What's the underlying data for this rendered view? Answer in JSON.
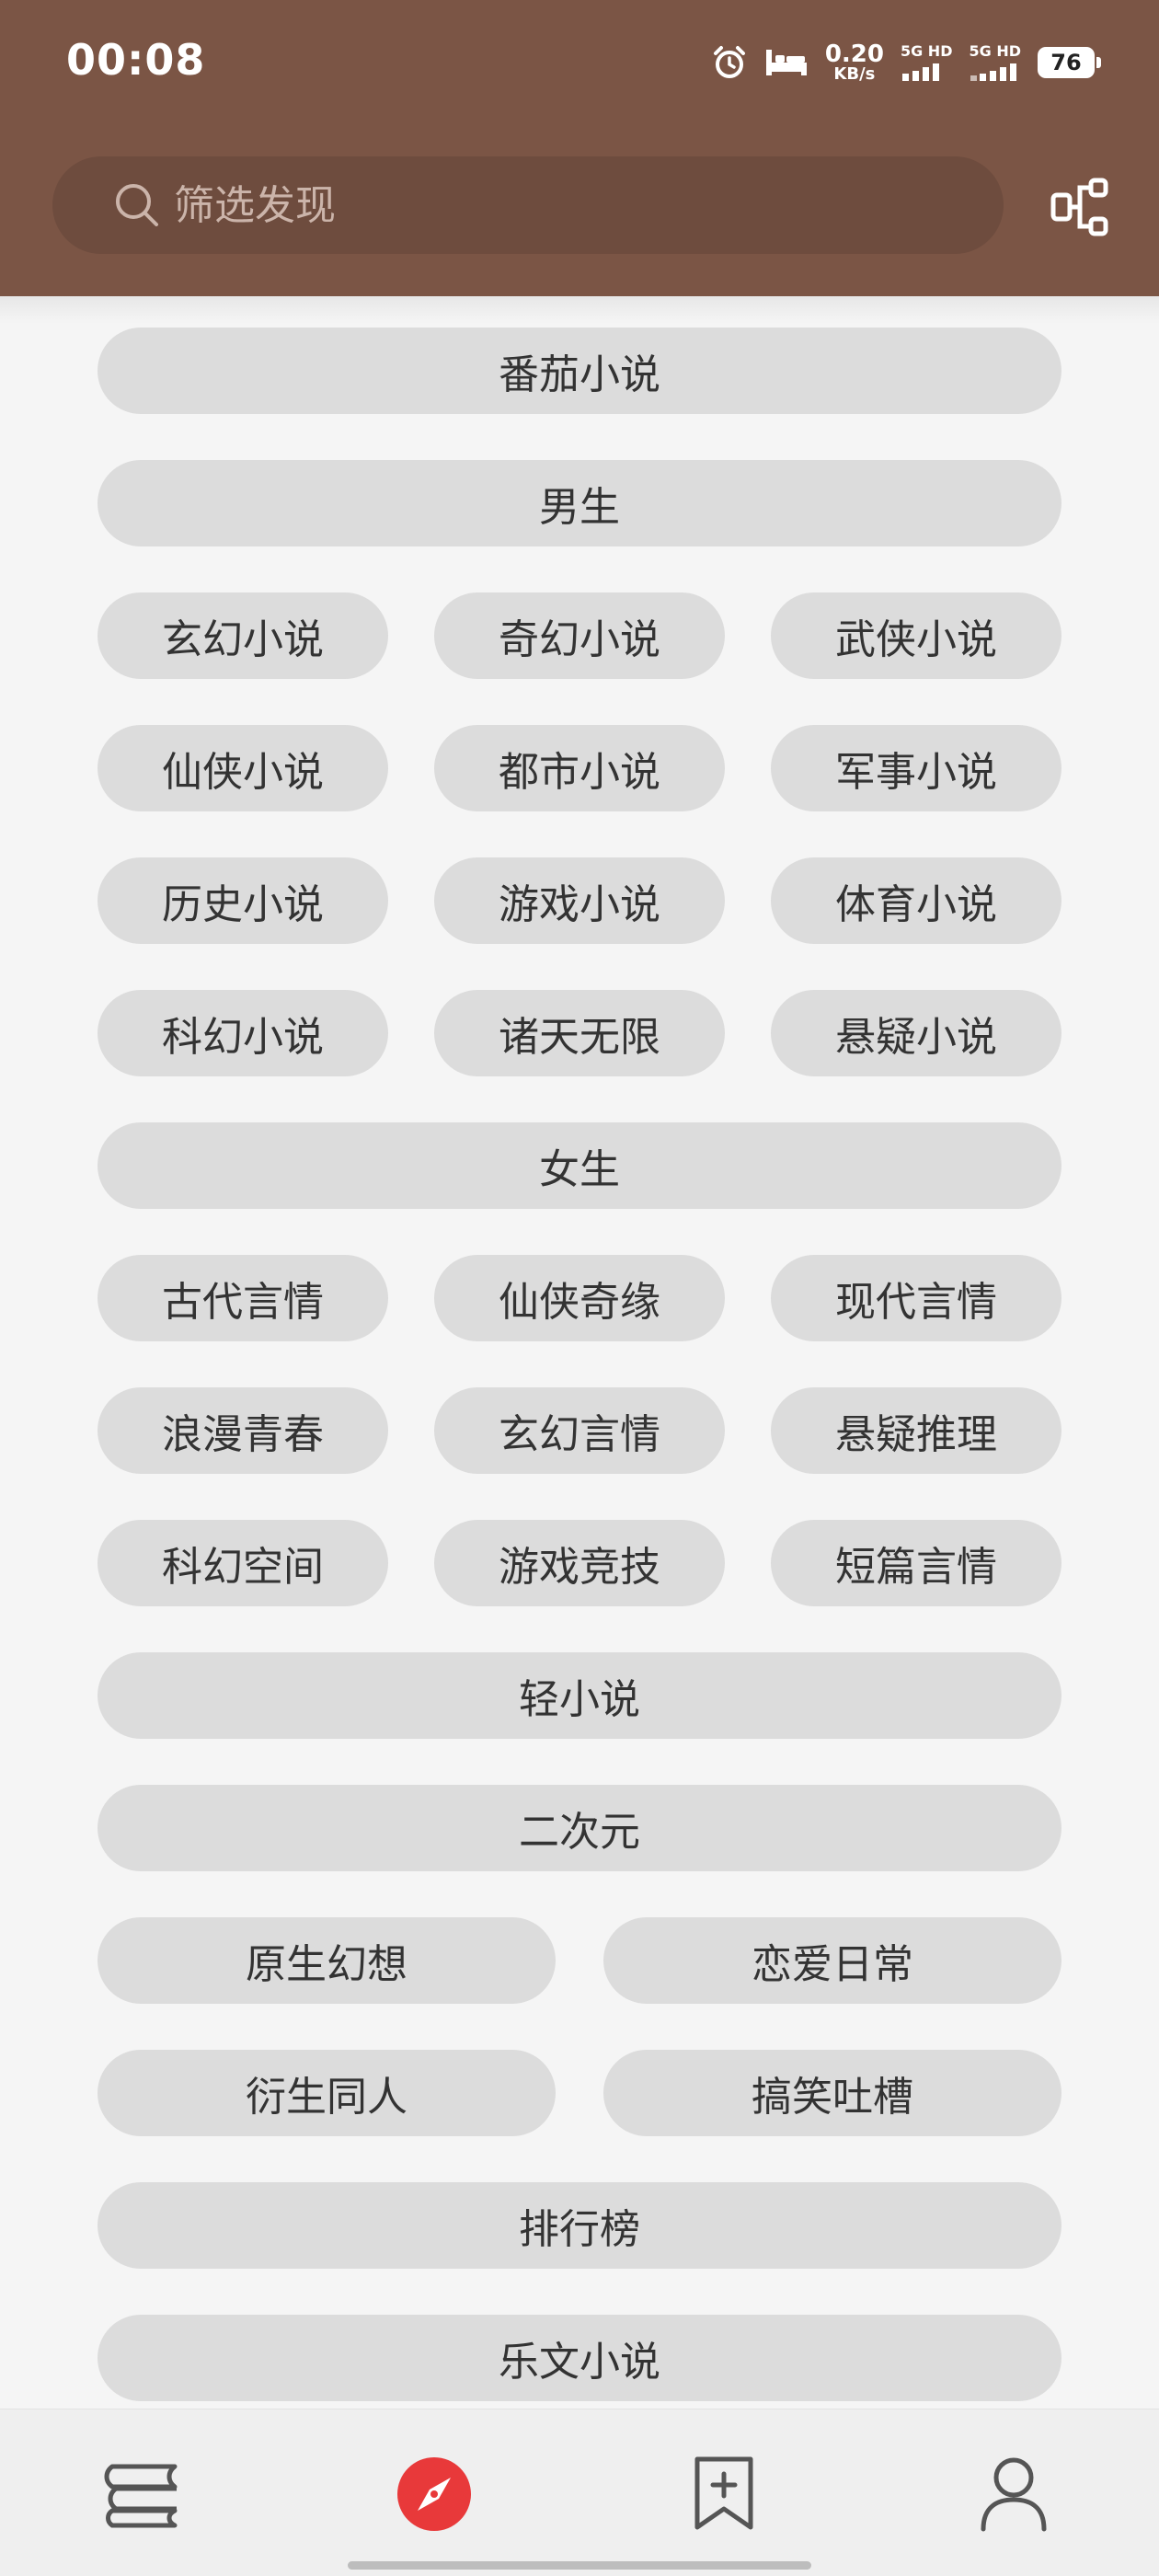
{
  "status_bar": {
    "time": "00:08",
    "net_speed_value": "0.20",
    "net_speed_unit": "KB/s",
    "sim1_label": "5G HD",
    "sim2_label": "5G HD",
    "battery_level": "76"
  },
  "search": {
    "placeholder": "筛选发现"
  },
  "categories": {
    "fanqie": "番茄小说",
    "male": "男生",
    "male_items": [
      "玄幻小说",
      "奇幻小说",
      "武侠小说",
      "仙侠小说",
      "都市小说",
      "军事小说",
      "历史小说",
      "游戏小说",
      "体育小说",
      "科幻小说",
      "诸天无限",
      "悬疑小说"
    ],
    "female": "女生",
    "female_items": [
      "古代言情",
      "仙侠奇缘",
      "现代言情",
      "浪漫青春",
      "玄幻言情",
      "悬疑推理",
      "科幻空间",
      "游戏竞技",
      "短篇言情"
    ],
    "light_novel": "轻小说",
    "acg": "二次元",
    "acg_items": [
      "原生幻想",
      "恋爱日常",
      "衍生同人",
      "搞笑吐槽"
    ],
    "ranking": "排行榜",
    "lewen": "乐文小说"
  },
  "colors": {
    "header": "#7b5545",
    "search_bg": "#6e4c3e",
    "pill_bg": "#dcdcdc",
    "accent": "#e8393a"
  },
  "bottom_nav_icons": [
    "bookshelf-icon",
    "discover-compass-icon",
    "bookmark-add-icon",
    "profile-icon"
  ]
}
